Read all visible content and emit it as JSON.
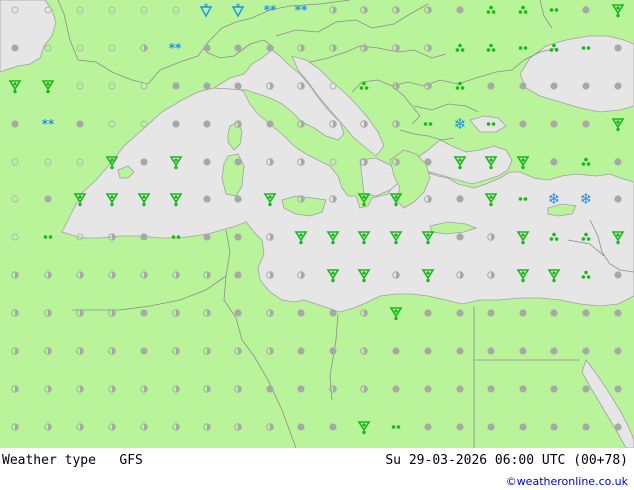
{
  "map": {
    "title": "Weather type",
    "model": "GFS",
    "valid_time": "Su 29-03-2026 06:00 UTC (00+78)",
    "credit": "©weatheronline.co.uk",
    "colors": {
      "land": "#b9f49a",
      "sea": "#e6e6e6",
      "border": "#8c8c8c",
      "coast": "#a0a0a0",
      "rain": "#17b817",
      "snow": "#1e90e8",
      "cloud": "#a8a8a8"
    },
    "legend_symbols": [
      "rain-showers-icon",
      "rain-drops-icon",
      "snow-icon",
      "snow-shower-icon",
      "overcast-icon",
      "partly-cloudy-icon",
      "clear-icon"
    ]
  }
}
